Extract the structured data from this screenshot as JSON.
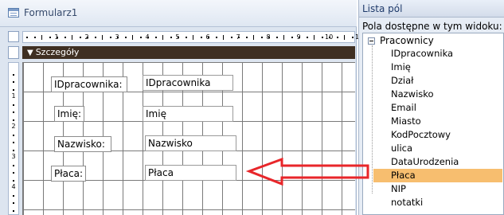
{
  "form": {
    "title": "Formularz1",
    "section_header": "Szczegóły",
    "ruler_top_numbers": [
      "1",
      "2",
      "3",
      "4",
      "5",
      "6",
      "7",
      "8",
      "9",
      "10",
      "11"
    ],
    "ruler_left_numbers": [
      "1",
      "2",
      "3",
      "4"
    ],
    "controls": [
      {
        "label": "IDpracownika:",
        "value": "IDpracownika"
      },
      {
        "label": "Imię:",
        "value": "Imię"
      },
      {
        "label": "Nazwisko:",
        "value": "Nazwisko"
      },
      {
        "label": "Płaca:",
        "value": "Płaca"
      }
    ]
  },
  "field_list": {
    "title": "Lista pól",
    "subtitle": "Pola dostępne w tym widoku:",
    "table_name": "Pracownicy",
    "fields": [
      "IDpracownika",
      "Imię",
      "Dział",
      "Nazwisko",
      "Email",
      "Miasto",
      "KodPocztowy",
      "ulica",
      "DataUrodzenia",
      "Płaca",
      "NIP",
      "notatki"
    ],
    "selected_field": "Płaca"
  },
  "colors": {
    "section_header_bg": "#3f2f22",
    "selected_field_bg": "#f7be6f",
    "arrow": "#e8262a"
  }
}
